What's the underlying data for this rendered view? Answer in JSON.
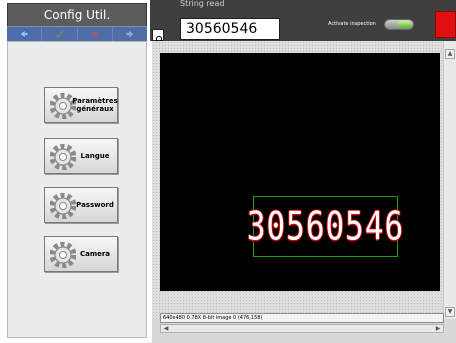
{
  "left_panel": {
    "title": "Config Util.",
    "nav_icons": [
      "arrow-left-icon",
      "check-icon",
      "close-icon",
      "arrow-right-icon"
    ],
    "buttons": [
      {
        "label": "Paramètres généraux",
        "icon": "gear-icon"
      },
      {
        "label": "Langue",
        "icon": "gear-icon"
      },
      {
        "label": "Password",
        "icon": "gear-icon"
      },
      {
        "label": "Camera",
        "icon": "gear-icon"
      }
    ]
  },
  "top_bar": {
    "string_read_label": "String read",
    "string_read_value": "30560546",
    "activate_label": "Activate inspection",
    "activate_on": true,
    "zoom_icon": "zoom-icon"
  },
  "image_view": {
    "detected_text": "30560546",
    "status": "640x480 0.78X 8-bit image 0    (476,158)"
  },
  "colors": {
    "panel_dark": "#3f3f3f",
    "nav_blue": "#4f6ea8",
    "roi_green": "#19a019",
    "stop_red": "#e01010"
  }
}
